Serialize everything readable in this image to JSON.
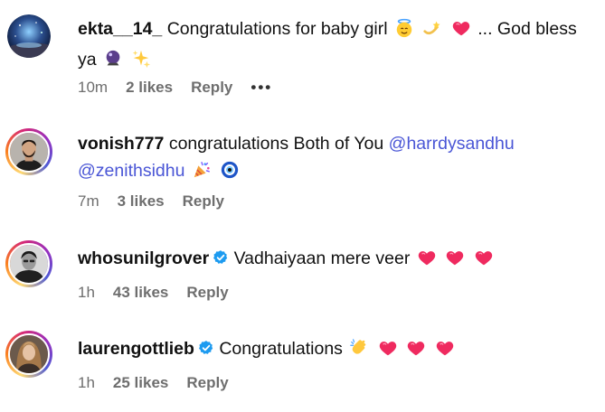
{
  "comments": [
    {
      "username": "ekta__14_",
      "text_parts": [
        "Congratulations for baby girl",
        "... God bless ya"
      ],
      "time": "10m",
      "likes": "2 likes",
      "reply": "Reply",
      "more": "•••"
    },
    {
      "username": "vonish777",
      "text": "congratulations Both of You",
      "mentions": [
        "@harrdysandhu",
        "@zenithsidhu"
      ],
      "time": "7m",
      "likes": "3 likes",
      "reply": "Reply"
    },
    {
      "username": "whosunilgrover",
      "text": "Vadhaiyaan mere veer",
      "verified": true,
      "time": "1h",
      "likes": "43 likes",
      "reply": "Reply"
    },
    {
      "username": "laurengottlieb",
      "text": "Congratulations",
      "verified": true,
      "time": "1h",
      "likes": "25 likes",
      "reply": "Reply"
    }
  ],
  "colors": {
    "mention": "#4a56d6",
    "verified": "#1d9bf0",
    "heart": "#ef2a5f",
    "meta": "#6e6e6e"
  },
  "icons": [
    "angel-emoji-icon",
    "dizzy-emoji-icon",
    "heart-emoji-icon",
    "crystal-ball-emoji-icon",
    "sparkles-emoji-icon",
    "party-popper-emoji-icon",
    "nazar-amulet-emoji-icon",
    "clapping-emoji-icon",
    "verified-badge-icon"
  ]
}
